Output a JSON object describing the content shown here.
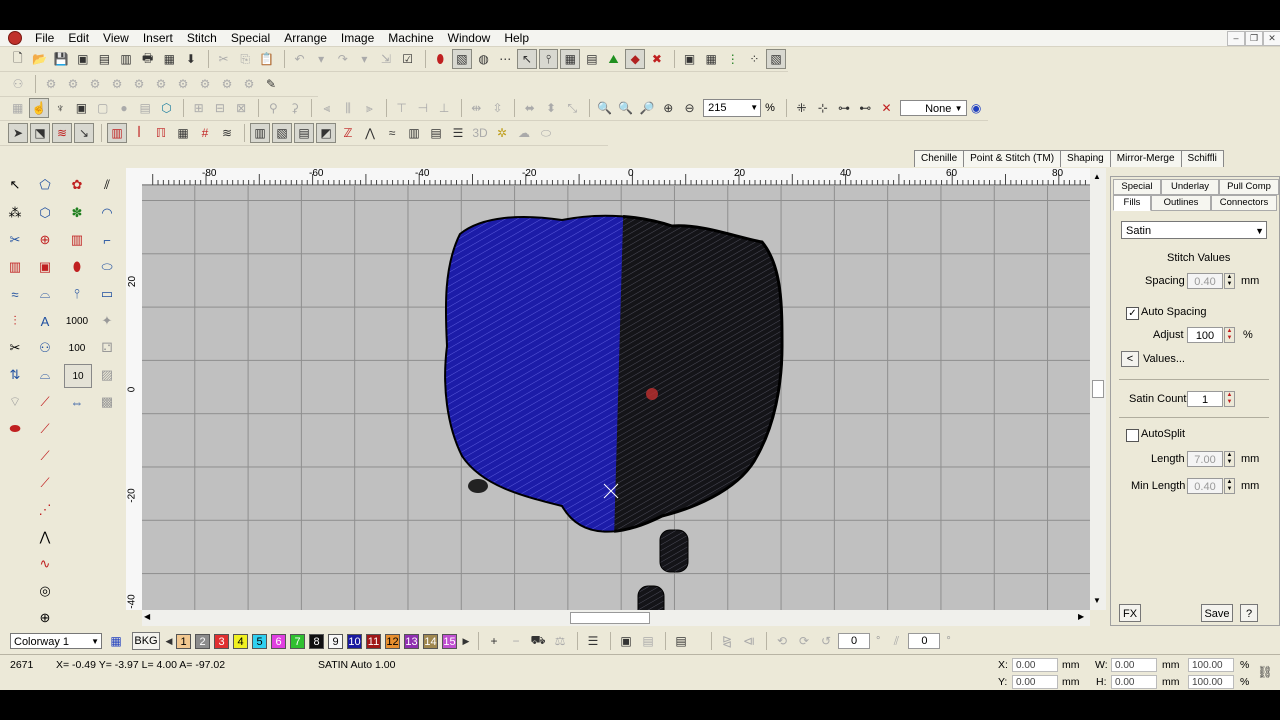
{
  "menu": [
    "File",
    "Edit",
    "View",
    "Insert",
    "Stitch",
    "Special",
    "Arrange",
    "Image",
    "Machine",
    "Window",
    "Help"
  ],
  "toolbar_zoom": {
    "value": "215",
    "unit": "%"
  },
  "toolbar_dropdown": {
    "value": "None"
  },
  "top_tabs": [
    "Chenille",
    "Point & Stitch (TM)",
    "Shaping",
    "Mirror-Merge",
    "Schiffli"
  ],
  "panel": {
    "tabs_row1": [
      "Special",
      "Underlay",
      "Pull Comp"
    ],
    "tabs_row2": [
      "Fills",
      "Outlines",
      "Connectors"
    ],
    "fill_type": "Satin",
    "stitch_values_title": "Stitch Values",
    "spacing_label": "Spacing",
    "spacing_value": "0.40",
    "spacing_unit": "mm",
    "auto_spacing_label": "Auto Spacing",
    "auto_spacing_checked": true,
    "adjust_label": "Adjust",
    "adjust_value": "100",
    "adjust_unit": "%",
    "values_button": "Values...",
    "values_arrow": "<",
    "satin_count_label": "Satin Count",
    "satin_count_value": "1",
    "autosplit_label": "AutoSplit",
    "autosplit_checked": false,
    "length_label": "Length",
    "length_value": "7.00",
    "length_unit": "mm",
    "min_length_label": "Min Length",
    "min_length_value": "0.40",
    "min_length_unit": "mm",
    "fx_button": "FX",
    "save_button": "Save",
    "help_button": "?"
  },
  "ruler": {
    "top": [
      "-80",
      "-60",
      "-40",
      "-20",
      "0",
      "20",
      "40",
      "60",
      "80"
    ],
    "left": [
      "20",
      "0",
      "-20",
      "-40"
    ]
  },
  "palette_labels": {
    "t1000": "1000",
    "t100": "100",
    "t10": "10"
  },
  "colorway": {
    "value": "Colorway 1",
    "bkg": "BKG",
    "swatches": [
      {
        "n": "1",
        "color": "#f2c890"
      },
      {
        "n": "2",
        "color": "#8c8c8c"
      },
      {
        "n": "3",
        "color": "#e03030"
      },
      {
        "n": "4",
        "color": "#f0f020"
      },
      {
        "n": "5",
        "color": "#30d0f0"
      },
      {
        "n": "6",
        "color": "#e040e0"
      },
      {
        "n": "7",
        "color": "#30c030"
      },
      {
        "n": "8",
        "color": "#101010"
      },
      {
        "n": "9",
        "color": "#f8f8f8"
      },
      {
        "n": "10",
        "color": "#1a1aa0"
      },
      {
        "n": "11",
        "color": "#a01818"
      },
      {
        "n": "12",
        "color": "#e89030"
      },
      {
        "n": "13",
        "color": "#9030b0"
      },
      {
        "n": "14",
        "color": "#a08850"
      },
      {
        "n": "15",
        "color": "#c050d0"
      }
    ],
    "field1": "0",
    "field2": "0"
  },
  "status": {
    "count": "2671",
    "coords": "X= -0.49 Y= -3.97 L= 4.00 A= -97.02",
    "stitch": "SATIN Auto  1.00",
    "x_label": "X:",
    "x_value": "0.00",
    "y_label": "Y:",
    "y_value": "0.00",
    "w_label": "W:",
    "w_value": "0.00",
    "h_label": "H:",
    "h_value": "0.00",
    "mm": "mm",
    "pct1": "100.00",
    "pct2": "100.00",
    "pct": "%"
  }
}
